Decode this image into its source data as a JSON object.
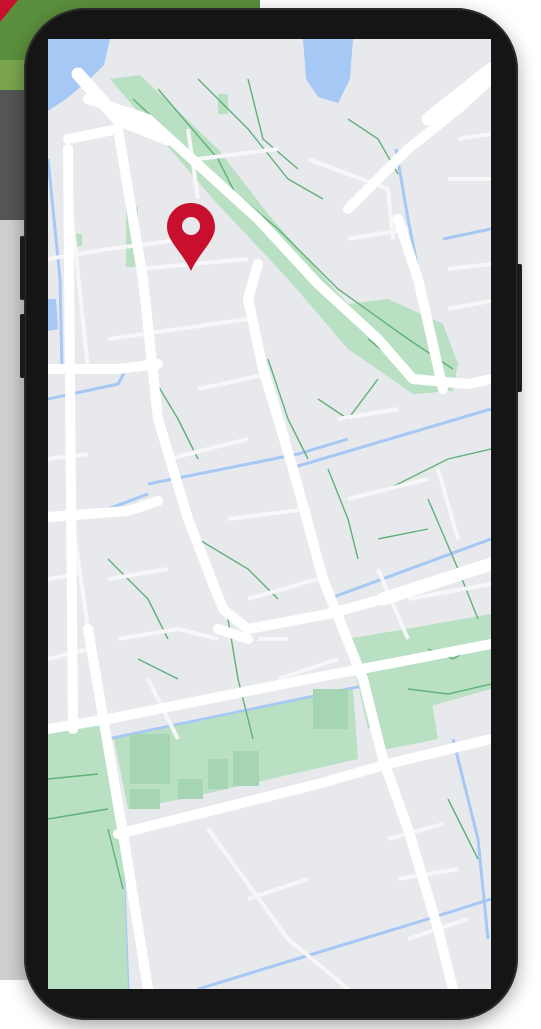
{
  "app": {
    "screen": "map"
  },
  "colors": {
    "land": "#e8e9ed",
    "road": "#ffffff",
    "street_minor": "#f7f7f9",
    "water": "#a6c8f5",
    "park": "#b9e0c3",
    "park_path": "#5fb17a",
    "pin": "#c8102e",
    "phone_frame": "#151515",
    "background_photo": "#6a6a6a",
    "grass": "#5a8f3d",
    "corner_ribbon": "#c8102e"
  },
  "map": {
    "marker": {
      "icon": "location-pin-icon"
    }
  }
}
